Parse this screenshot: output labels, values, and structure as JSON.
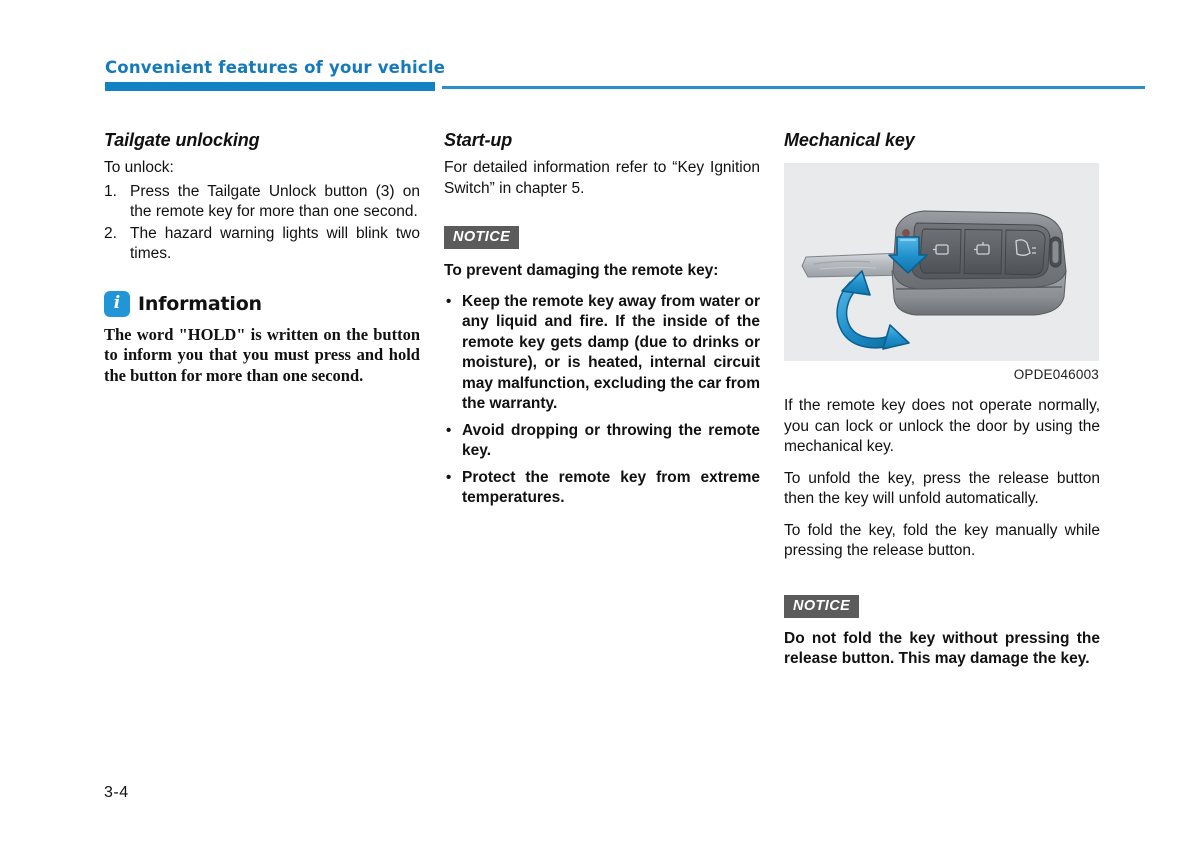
{
  "header": {
    "chapter_title": "Convenient features of your vehicle",
    "accent_color": "#1282c5"
  },
  "footer": {
    "page_number": "3-4"
  },
  "column1": {
    "heading": "Tailgate unlocking",
    "intro": "To unlock:",
    "steps": [
      {
        "num": "1.",
        "text": "Press the Tailgate Unlock button (3) on the remote key for more than one second."
      },
      {
        "num": "2.",
        "text": "The hazard warning lights will blink two times."
      }
    ],
    "information": {
      "icon": "info-icon",
      "title": "Information",
      "body": "The word \"HOLD\" is written on the button to inform you that you must press and hold the button for more than one second."
    }
  },
  "column2": {
    "heading": "Start-up",
    "paragraph": "For detailed information refer to “Key Ignition Switch” in chapter 5.",
    "notice_label": "NOTICE",
    "notice_lead": "To prevent damaging the remote key:",
    "notice_bullets": [
      "Keep the remote key away from water or any liquid and fire. If the inside of the remote key gets damp (due to drinks or moisture), or is heated, internal circuit may malfunction, excluding the car from the warranty.",
      "Avoid dropping or throwing the remote key.",
      "Protect the remote key from extreme temperatures."
    ]
  },
  "column3": {
    "heading": "Mechanical key",
    "figure": {
      "name": "remote-key-unfold-illustration",
      "caption": "OPDE046003",
      "background_color": "#e9eaec",
      "arrow_color": "#2b9ad6",
      "buttons": [
        "lock-button",
        "unlock-button",
        "tailgate-button"
      ],
      "callout": "release-button-down-arrow"
    },
    "paragraphs": [
      "If the remote key does not operate normally, you can lock or unlock the door by using the mechanical key.",
      "To unfold the key, press the release button then the key will unfold automatically.",
      "To fold the key, fold the key manually while pressing the release button."
    ],
    "notice_label": "NOTICE",
    "notice_body": "Do not fold the key without pressing the release button. This may damage the key."
  }
}
